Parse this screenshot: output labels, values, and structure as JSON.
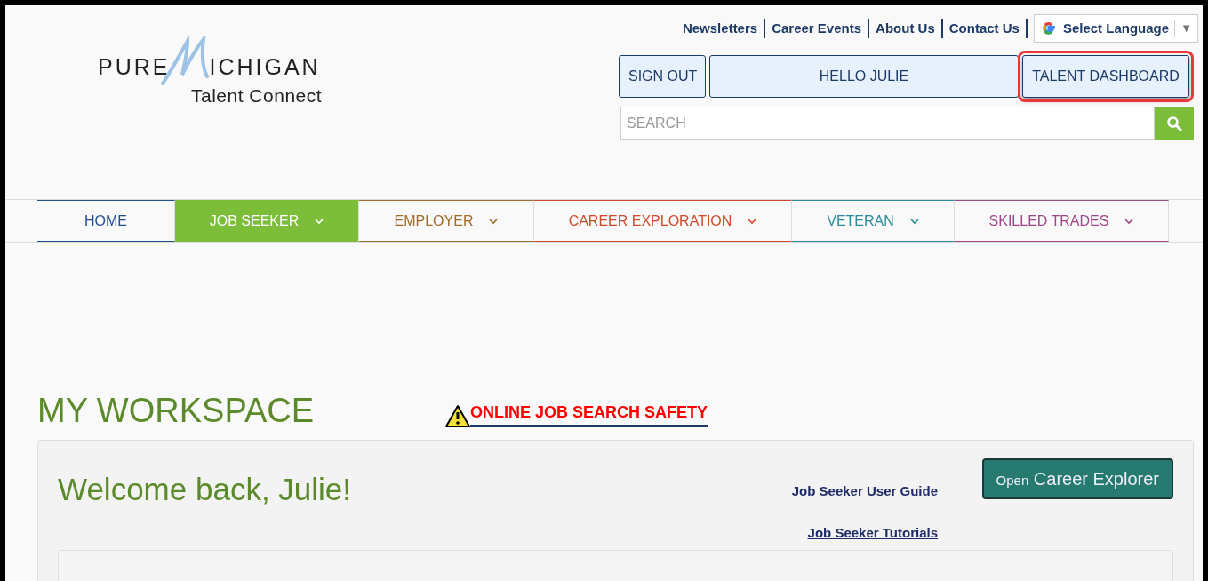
{
  "logo": {
    "word_left": "PURE",
    "word_right": "ICHIGAN",
    "tagline": "Talent Connect"
  },
  "top_links": [
    "Newsletters",
    "Career Events",
    "About Us",
    "Contact Us"
  ],
  "language_select": {
    "label": "Select Language",
    "arrow": "▼"
  },
  "account_buttons": [
    {
      "label": "SIGN OUT",
      "highlighted": false
    },
    {
      "label": "HELLO JULIE",
      "highlighted": false
    },
    {
      "label": "TALENT DASHBOARD",
      "highlighted": true
    }
  ],
  "search": {
    "placeholder": "SEARCH"
  },
  "nav_tabs": [
    {
      "label": "HOME",
      "selected": false,
      "dropdown": false,
      "color": "#1f4e8c"
    },
    {
      "label": "JOB SEEKER",
      "selected": true,
      "dropdown": true,
      "color": "#7cbd3a"
    },
    {
      "label": "EMPLOYER",
      "selected": false,
      "dropdown": true,
      "color": "#a06a28"
    },
    {
      "label": "CAREER EXPLORATION",
      "selected": false,
      "dropdown": true,
      "color": "#d04a2a"
    },
    {
      "label": "VETERAN",
      "selected": false,
      "dropdown": true,
      "color": "#2a8a9a"
    },
    {
      "label": "SKILLED TRADES",
      "selected": false,
      "dropdown": true,
      "color": "#a0478a"
    }
  ],
  "page_title": "MY WORKSPACE",
  "safety_link": "ONLINE JOB SEARCH SAFETY",
  "welcome": {
    "heading": "Welcome back, Julie!",
    "links": [
      "Job Seeker User Guide",
      "Job Seeker Tutorials"
    ],
    "button": {
      "small": "Open",
      "large": "Career Explorer"
    }
  }
}
